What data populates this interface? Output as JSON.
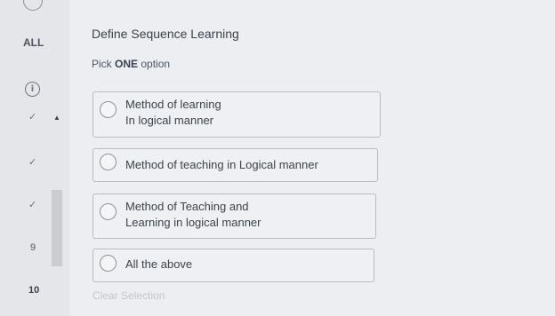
{
  "sidebar": {
    "all_label": "ALL",
    "info_glyph": "i",
    "check_glyph": "✓",
    "scroll_up_glyph": "▲",
    "items": [
      {
        "label": "9"
      },
      {
        "label": "10"
      }
    ]
  },
  "question": {
    "text": "Define Sequence Learning",
    "pick_prefix": "Pick",
    "pick_bold": "ONE",
    "pick_suffix": "option"
  },
  "options": [
    {
      "lines": [
        "Method of learning",
        "In logical manner"
      ]
    },
    {
      "lines": [
        "Method of teaching in Logical manner"
      ]
    },
    {
      "lines": [
        "Method of Teaching and",
        "Learning in logical manner"
      ]
    },
    {
      "lines": [
        "All the above"
      ]
    }
  ],
  "clear_selection_label": "Clear Selection"
}
